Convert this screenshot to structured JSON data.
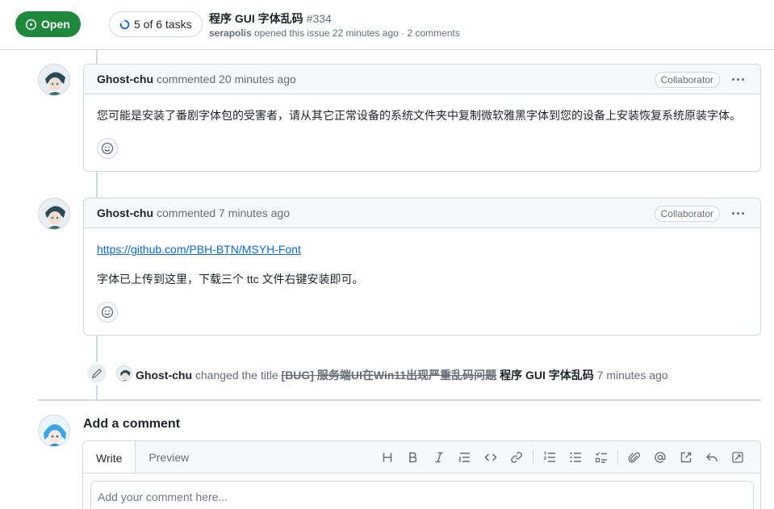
{
  "header": {
    "state": "Open",
    "tasks": "5 of 6 tasks",
    "title": "程序 GUI 字体乱码",
    "number": "#334",
    "author": "serapolis",
    "meta": " opened this issue 22 minutes ago · 2 comments"
  },
  "comments": [
    {
      "author": "Ghost-chu",
      "action": "commented 20 minutes ago",
      "badge": "Collaborator",
      "body": "您可能是安装了番剧字体包的受害者，请从其它正常设备的系统文件夹中复制微软雅黑字体到您的设备上安装恢复系统原装字体。"
    },
    {
      "author": "Ghost-chu",
      "action": "commented 7 minutes ago",
      "badge": "Collaborator",
      "link": "https://github.com/PBH-BTN/MSYH-Font",
      "body": "字体已上传到这里，下载三个 ttc 文件右键安装即可。"
    }
  ],
  "rename_event": {
    "author": "Ghost-chu",
    "text": "changed the title",
    "old_title": "[BUG] 服务端UI在Win11出现严重乱码问题",
    "new_title": "程序 GUI 字体乱码",
    "time": "7 minutes ago"
  },
  "add_comment": {
    "title": "Add a comment",
    "tabs": [
      "Write",
      "Preview"
    ],
    "placeholder": "Add your comment here..."
  },
  "colors": {
    "open_green": "#1f883d",
    "link_blue": "#0969da",
    "border": "#d0d7de",
    "muted": "#656d76"
  }
}
